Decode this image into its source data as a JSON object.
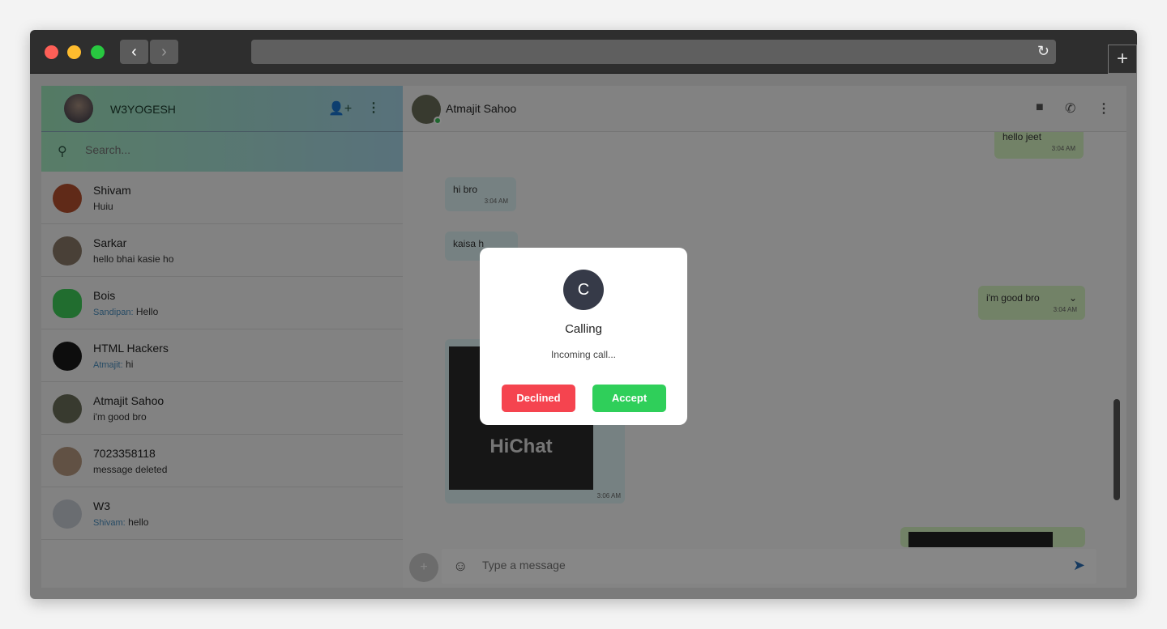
{
  "browser": {
    "back": "‹",
    "forward": "›",
    "reload": "↻",
    "new_tab": "+"
  },
  "sidebar": {
    "user": "W3YOGESH",
    "search_placeholder": "Search...",
    "chats": [
      {
        "name": "Shivam",
        "message": "Huiu",
        "sender": ""
      },
      {
        "name": "Sarkar",
        "message": "hello bhai kasie ho",
        "sender": ""
      },
      {
        "name": "Bois",
        "message": "Hello",
        "sender": "Sandipan:"
      },
      {
        "name": "HTML Hackers",
        "message": "hi",
        "sender": "Atmajit:"
      },
      {
        "name": "Atmajit Sahoo",
        "message": "i'm good bro",
        "sender": ""
      },
      {
        "name": "7023358118",
        "message": "message deleted",
        "sender": ""
      },
      {
        "name": "W3",
        "message": "hello",
        "sender": "Shivam:"
      }
    ]
  },
  "chat": {
    "contact": "Atmajit Sahoo",
    "status_color": "#3cc25a",
    "messages": [
      {
        "text": "hello jeet",
        "time": "3:04 AM",
        "dir": "out"
      },
      {
        "text": "hi bro",
        "time": "3:04 AM",
        "dir": "in"
      },
      {
        "text": "kaisa h",
        "time": "",
        "dir": "in"
      },
      {
        "text": "i'm good bro",
        "time": "3:04 AM",
        "dir": "out"
      },
      {
        "image_text": "HiChat",
        "time": "3:06 AM",
        "dir": "in"
      }
    ],
    "input_placeholder": "Type a message"
  },
  "modal": {
    "avatar_letter": "C",
    "title": "Calling",
    "subtitle": "Incoming call...",
    "decline": "Declined",
    "accept": "Accept",
    "decline_color": "#f5444f",
    "accept_color": "#2fcf5a"
  }
}
